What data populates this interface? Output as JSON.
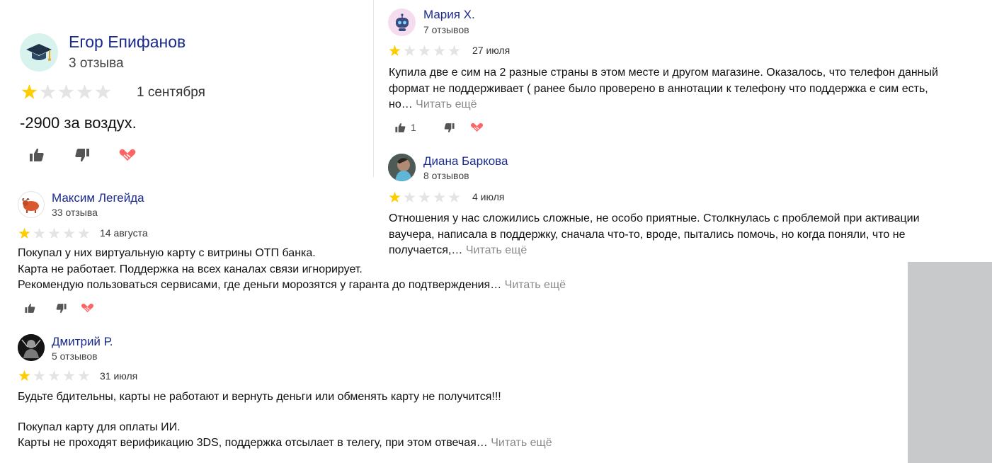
{
  "reviews": [
    {
      "name": "Егор Епифанов",
      "count": "3 отзыва",
      "rating": 1,
      "date": "1 сентября",
      "lines": [
        "-2900 за воздух."
      ],
      "more": "",
      "likes": "",
      "avatar_icon": "graduation-cap-icon"
    },
    {
      "name": "Мария Х.",
      "count": "7 отзывов",
      "rating": 1,
      "date": "27 июля",
      "lines": [
        "Купила две е сим на 2 разные страны в этом месте и другом магазине. Оказалось, что телефон данный",
        "формат не поддерживает ( ранее было проверено в аннотации к телефону что поддержка е сим есть,",
        "но…"
      ],
      "more": "Читать ещё",
      "likes": "1",
      "avatar_icon": "robot-icon"
    },
    {
      "name": "Диана Баркова",
      "count": "8 отзывов",
      "rating": 1,
      "date": "4 июля",
      "lines": [
        "Отношения у нас сложились сложные, не особо приятные. Столкнулась с проблемой при активации",
        "ваучера, написала в поддержку, сначала что-то, вроде, пытались помочь, но когда поняли, что не",
        "получается,…"
      ],
      "more": "Читать ещё",
      "likes": "",
      "avatar_icon": "user-photo-icon"
    },
    {
      "name": "Максим Легейда",
      "count": "33 отзыва",
      "rating": 1,
      "date": "14 августа",
      "lines": [
        "Покупал у них виртуальную карту с витрины ОТП банка.",
        "Карта не работает. Поддержка на всех каналах связи игнорирует.",
        "Рекомендую пользоваться сервисами, где деньги морозятся у гаранта до подтверждения…"
      ],
      "more": "Читать ещё",
      "likes": "",
      "avatar_icon": "yak-icon"
    },
    {
      "name": "Дмитрий Р.",
      "count": "5 отзывов",
      "rating": 1,
      "date": "31 июля",
      "lines": [
        "Будьте бдительны, карты не работают и вернуть деньги или обменять карту не получится!!!",
        "",
        "Покупал карту для оплаты ИИ.",
        "Карты не проходят верификацию 3DS, поддержка отсылает в телегу, при этом отвечая…"
      ],
      "more": "Читать ещё",
      "likes": "",
      "avatar_icon": "user-photo-icon"
    }
  ],
  "colors": {
    "star_on": "#ffcc00",
    "star_off": "#e4e4e4",
    "name": "#1a2a8c",
    "more": "#8a8a8a"
  }
}
